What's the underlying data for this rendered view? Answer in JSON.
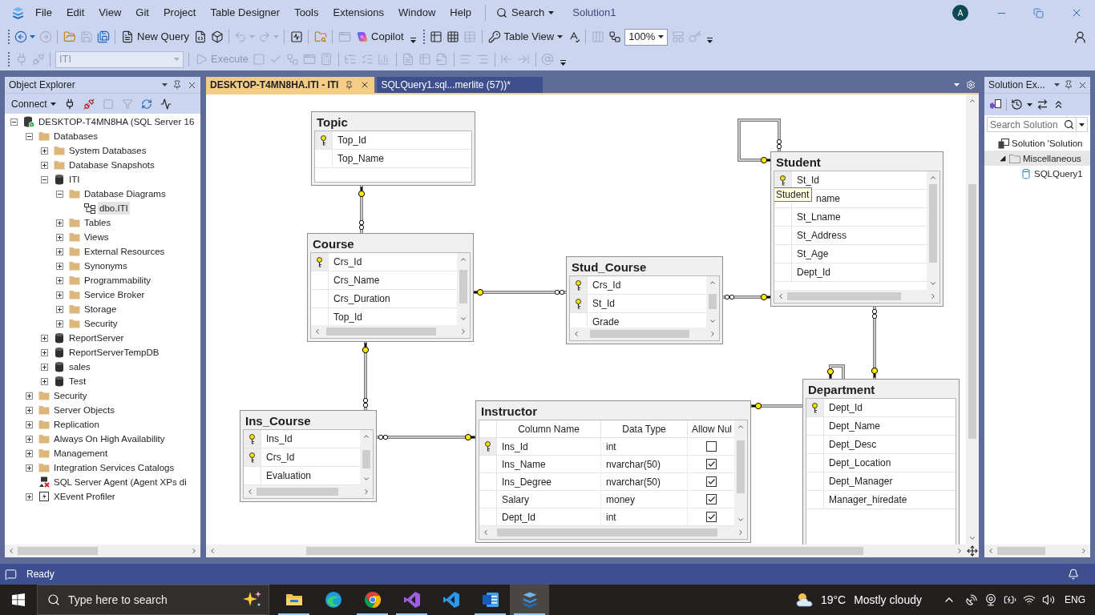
{
  "menu_bar": {
    "menus": [
      "File",
      "Edit",
      "View",
      "Git",
      "Project",
      "Table Designer",
      "Tools",
      "Extensions",
      "Window",
      "Help"
    ],
    "search": "Search",
    "solution_name": "Solution1",
    "account_initial": "A"
  },
  "toolbar_1": [
    {
      "kind": "split",
      "disabled": false
    },
    {
      "kind": "icon",
      "disabled": true
    },
    {
      "kind": "icon",
      "disabled": false
    },
    {
      "kind": "icon",
      "disabled": true
    },
    {
      "kind": "icon",
      "disabled": false
    },
    {
      "kind": "button",
      "label": "New Query",
      "disabled": false
    },
    {
      "kind": "icon",
      "disabled": false
    },
    {
      "kind": "icon",
      "disabled": false
    },
    {
      "kind": "split",
      "disabled": true
    },
    {
      "kind": "split",
      "disabled": true
    },
    {
      "kind": "icon",
      "disabled": false
    },
    {
      "kind": "icon",
      "disabled": false
    },
    {
      "kind": "icon",
      "disabled": true
    },
    {
      "kind": "button",
      "label": "Copilot",
      "disabled": false
    },
    {
      "kind": "caret",
      "disabled": false
    },
    {
      "kind": "icon",
      "disabled": false
    },
    {
      "kind": "icon",
      "disabled": false
    },
    {
      "kind": "icon",
      "disabled": true
    },
    {
      "kind": "dropdown",
      "label": "Table View",
      "disabled": false
    },
    {
      "kind": "icon",
      "disabled": false
    },
    {
      "kind": "icon",
      "disabled": true
    },
    {
      "kind": "icon",
      "disabled": false
    },
    {
      "kind": "select",
      "value": "100%",
      "disabled": false
    },
    {
      "kind": "icon",
      "disabled": true
    },
    {
      "kind": "icon",
      "disabled": true
    },
    {
      "kind": "caret",
      "disabled": false
    }
  ],
  "toolbar_2": [
    {
      "kind": "icon",
      "disabled": true
    },
    {
      "kind": "icon",
      "disabled": true
    },
    {
      "kind": "select",
      "value": "ITI",
      "disabled": true
    },
    {
      "kind": "button",
      "label": "Execute",
      "disabled": true
    },
    {
      "kind": "icon",
      "disabled": true
    },
    {
      "kind": "icon",
      "disabled": true
    },
    {
      "kind": "icon",
      "disabled": true
    },
    {
      "kind": "icon",
      "disabled": true
    },
    {
      "kind": "icon",
      "disabled": true
    },
    {
      "kind": "icon",
      "disabled": true
    },
    {
      "kind": "icon",
      "disabled": true
    },
    {
      "kind": "icon",
      "disabled": true
    },
    {
      "kind": "icon",
      "disabled": true
    },
    {
      "kind": "icon",
      "disabled": true
    },
    {
      "kind": "icon",
      "disabled": true
    },
    {
      "kind": "icon",
      "disabled": true
    },
    {
      "kind": "icon",
      "disabled": true
    },
    {
      "kind": "icon",
      "disabled": true
    },
    {
      "kind": "icon",
      "disabled": true
    },
    {
      "kind": "icon",
      "disabled": true
    },
    {
      "kind": "caret",
      "disabled": false
    }
  ],
  "object_explorer": {
    "title": "Object Explorer",
    "connect": "Connect",
    "toolbar": [
      {
        "disabled": false
      },
      {
        "disabled": false
      },
      {
        "disabled": true
      },
      {
        "disabled": true
      },
      {
        "disabled": false
      },
      {
        "disabled": false
      }
    ],
    "tree": [
      {
        "label": "DESKTOP-T4MN8HA (SQL Server 16",
        "kind": "server",
        "expanded": true,
        "selected": false,
        "children": [
          {
            "label": "Databases",
            "kind": "folder",
            "expanded": true,
            "selected": false,
            "children": [
              {
                "label": "System Databases",
                "kind": "folder",
                "expanded": false,
                "selected": false
              },
              {
                "label": "Database Snapshots",
                "kind": "folder",
                "expanded": false,
                "selected": false
              },
              {
                "label": "ITI",
                "kind": "database",
                "expanded": true,
                "selected": false,
                "children": [
                  {
                    "label": "Database Diagrams",
                    "kind": "folder",
                    "expanded": true,
                    "selected": false,
                    "children": [
                      {
                        "label": "dbo.ITI",
                        "kind": "diagram",
                        "selected": true
                      }
                    ]
                  },
                  {
                    "label": "Tables",
                    "kind": "folder",
                    "expanded": false,
                    "selected": false
                  },
                  {
                    "label": "Views",
                    "kind": "folder",
                    "expanded": false,
                    "selected": false
                  },
                  {
                    "label": "External Resources",
                    "kind": "folder",
                    "expanded": false,
                    "selected": false
                  },
                  {
                    "label": "Synonyms",
                    "kind": "folder",
                    "expanded": false,
                    "selected": false
                  },
                  {
                    "label": "Programmability",
                    "kind": "folder",
                    "expanded": false,
                    "selected": false
                  },
                  {
                    "label": "Service Broker",
                    "kind": "folder",
                    "expanded": false,
                    "selected": false
                  },
                  {
                    "label": "Storage",
                    "kind": "folder",
                    "expanded": false,
                    "selected": false
                  },
                  {
                    "label": "Security",
                    "kind": "folder",
                    "expanded": false,
                    "selected": false
                  }
                ]
              },
              {
                "label": "ReportServer",
                "kind": "database",
                "expanded": false,
                "selected": false
              },
              {
                "label": "ReportServerTempDB",
                "kind": "database",
                "expanded": false,
                "selected": false
              },
              {
                "label": "sales",
                "kind": "database",
                "expanded": false,
                "selected": false
              },
              {
                "label": "Test",
                "kind": "database",
                "expanded": false,
                "selected": false
              }
            ]
          },
          {
            "label": "Security",
            "kind": "folder",
            "expanded": false,
            "selected": false
          },
          {
            "label": "Server Objects",
            "kind": "folder",
            "expanded": false,
            "selected": false
          },
          {
            "label": "Replication",
            "kind": "folder",
            "expanded": false,
            "selected": false
          },
          {
            "label": "Always On High Availability",
            "kind": "folder",
            "expanded": false,
            "selected": false
          },
          {
            "label": "Management",
            "kind": "folder",
            "expanded": false,
            "selected": false
          },
          {
            "label": "Integration Services Catalogs",
            "kind": "folder",
            "expanded": false,
            "selected": false
          },
          {
            "label": "SQL Server Agent (Agent XPs di",
            "kind": "agent",
            "selected": false
          },
          {
            "label": "XEvent Profiler",
            "kind": "profiler",
            "expanded": false,
            "selected": false
          }
        ]
      }
    ]
  },
  "document_tabs": [
    {
      "label": "DESKTOP-T4MN8HA.ITI - ITI",
      "selected": true
    },
    {
      "label": "SQLQuery1.sql...merlite (57))*",
      "selected": false
    }
  ],
  "diagram": {
    "tables": [
      {
        "name": "Topic",
        "kind": "column_names",
        "columns": [
          {
            "name": "Top_Id",
            "key": true
          },
          {
            "name": "Top_Name",
            "key": false
          }
        ]
      },
      {
        "name": "Course",
        "kind": "column_names",
        "columns": [
          {
            "name": "Crs_Id",
            "key": true
          },
          {
            "name": "Crs_Name",
            "key": false
          },
          {
            "name": "Crs_Duration",
            "key": false
          },
          {
            "name": "Top_Id",
            "key": false
          }
        ]
      },
      {
        "name": "Stud_Course",
        "kind": "column_names",
        "columns": [
          {
            "name": "Crs_Id",
            "key": true
          },
          {
            "name": "St_Id",
            "key": true
          },
          {
            "name": "Grade",
            "key": false
          }
        ]
      },
      {
        "name": "Student",
        "kind": "column_names",
        "columns": [
          {
            "name": "St_Id",
            "key": true
          },
          {
            "name": "name",
            "key": false,
            "tooltip": "Student"
          },
          {
            "name": "St_Lname",
            "key": false
          },
          {
            "name": "St_Address",
            "key": false
          },
          {
            "name": "St_Age",
            "key": false
          },
          {
            "name": "Dept_Id",
            "key": false
          }
        ]
      },
      {
        "name": "Ins_Course",
        "kind": "column_names",
        "columns": [
          {
            "name": "Ins_Id",
            "key": true
          },
          {
            "name": "Crs_Id",
            "key": true
          },
          {
            "name": "Evaluation",
            "key": false
          }
        ]
      },
      {
        "name": "Instructor",
        "kind": "standard",
        "headers": [
          "Column Name",
          "Data Type",
          "Allow Nul"
        ],
        "columns": [
          {
            "name": "Ins_Id",
            "type": "int",
            "allow_nulls": false,
            "key": true
          },
          {
            "name": "Ins_Name",
            "type": "nvarchar(50)",
            "allow_nulls": true,
            "key": false
          },
          {
            "name": "Ins_Degree",
            "type": "nvarchar(50)",
            "allow_nulls": true,
            "key": false
          },
          {
            "name": "Salary",
            "type": "money",
            "allow_nulls": true,
            "key": false
          },
          {
            "name": "Dept_Id",
            "type": "int",
            "allow_nulls": true,
            "key": false
          }
        ]
      },
      {
        "name": "Department",
        "kind": "column_names",
        "columns": [
          {
            "name": "Dept_Id",
            "key": true
          },
          {
            "name": "Dept_Name",
            "key": false
          },
          {
            "name": "Dept_Desc",
            "key": false
          },
          {
            "name": "Dept_Location",
            "key": false
          },
          {
            "name": "Dept_Manager",
            "key": false
          },
          {
            "name": "Manager_hiredate",
            "key": false
          }
        ]
      }
    ]
  },
  "solution_explorer": {
    "title": "Solution Ex...",
    "search_placeholder": "Search Solution",
    "tree": [
      {
        "label": "Solution 'Solution",
        "kind": "solution",
        "selected": false,
        "children": [
          {
            "label": "Miscellaneous",
            "kind": "folder",
            "expanded": true,
            "selected": true,
            "children": [
              {
                "label": "SQLQuery1",
                "kind": "file",
                "selected": false
              }
            ]
          }
        ]
      }
    ]
  },
  "status_bar": {
    "text": "Ready"
  },
  "taskbar": {
    "search_placeholder": "Type here to search",
    "apps": [
      {
        "running": true,
        "selected": false
      },
      {
        "running": false,
        "selected": false
      },
      {
        "running": true,
        "selected": false
      },
      {
        "running": true,
        "selected": false
      },
      {
        "running": false,
        "selected": false
      },
      {
        "running": true,
        "selected": false
      },
      {
        "running": true,
        "selected": true
      }
    ],
    "temperature": "19°C",
    "weather": "Mostly cloudy",
    "language": "ENG"
  }
}
